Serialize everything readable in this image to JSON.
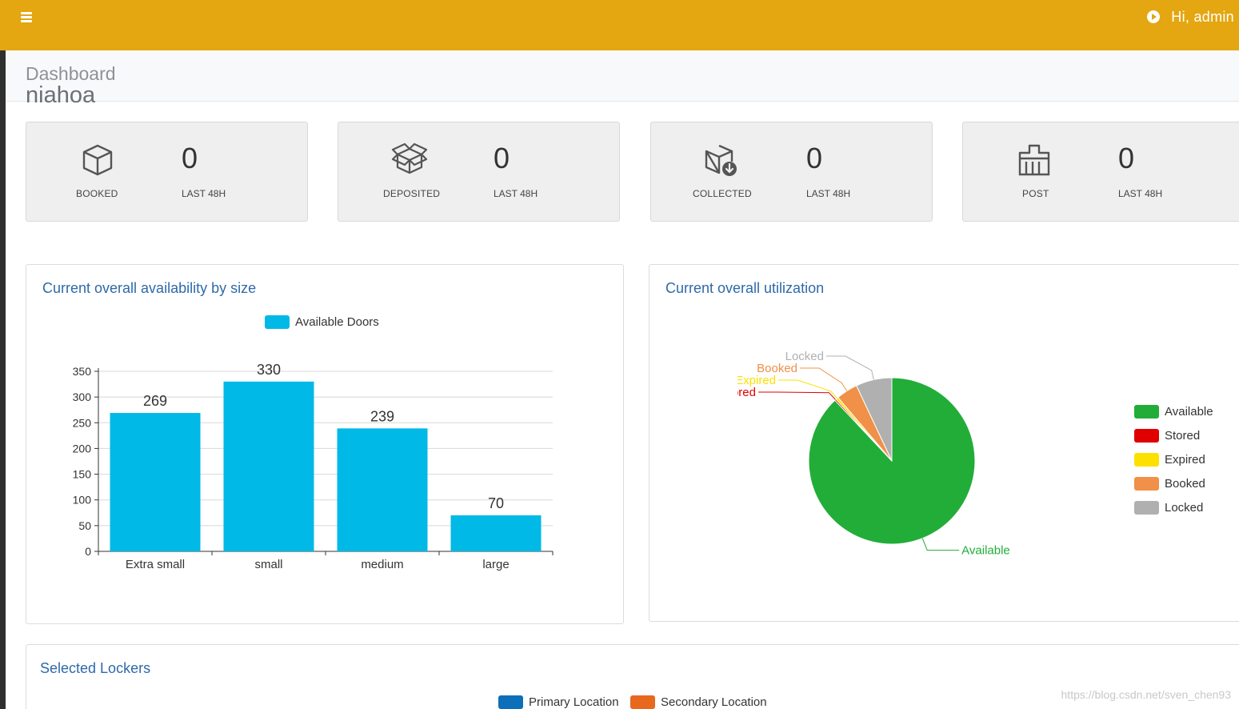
{
  "header": {
    "user_greeting": "Hi, admin"
  },
  "page": {
    "title": "Dashboard",
    "subtitle": "niahoa"
  },
  "stats": [
    {
      "label": "BOOKED",
      "value": "0",
      "period": "LAST 48H",
      "icon": "cube-icon"
    },
    {
      "label": "DEPOSITED",
      "value": "0",
      "period": "LAST 48H",
      "icon": "open-box-icon"
    },
    {
      "label": "COLLECTED",
      "value": "0",
      "period": "LAST 48H",
      "icon": "box-download-icon"
    },
    {
      "label": "POST",
      "value": "0",
      "period": "LAST 48H",
      "icon": "mailbox-icon"
    }
  ],
  "availability": {
    "title": "Current overall availability by size",
    "chart_data": {
      "type": "bar",
      "categories": [
        "Extra small",
        "small",
        "medium",
        "large"
      ],
      "series": [
        {
          "name": "Available Doors",
          "values": [
            269,
            330,
            239,
            70
          ],
          "color": "#00b9e6"
        }
      ],
      "ylim": [
        0,
        350
      ],
      "yticks": [
        0,
        50,
        100,
        150,
        200,
        250,
        300,
        350
      ],
      "grid": true,
      "legend": "top"
    }
  },
  "utilization": {
    "title": "Current overall utilization",
    "chart_data": {
      "type": "pie",
      "labels": [
        "Available",
        "Stored",
        "Expired",
        "Booked",
        "Locked"
      ],
      "values": [
        88,
        0.3,
        0.5,
        4.2,
        7
      ],
      "colors": [
        "#22ad38",
        "#e00000",
        "#fce100",
        "#f09049",
        "#b0b0b0"
      ],
      "legend": "right"
    }
  },
  "lockers": {
    "title": "Selected Lockers",
    "legend": [
      {
        "name": "Primary Location",
        "color": "#0d6fba"
      },
      {
        "name": "Secondary Location",
        "color": "#e8681e"
      }
    ]
  },
  "watermark": "https://blog.csdn.net/sven_chen93"
}
